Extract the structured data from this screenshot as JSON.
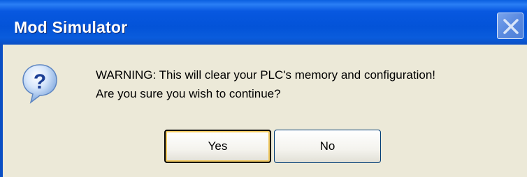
{
  "window": {
    "title": "Mod Simulator"
  },
  "icons": {
    "dialog_icon": "question-icon",
    "close_icon": "close-icon"
  },
  "message": {
    "line1": "WARNING: This will clear your PLC's memory and configuration!",
    "line2": "Are you sure you wish to continue?"
  },
  "buttons": {
    "yes_label": "Yes",
    "no_label": "No"
  },
  "colors": {
    "titlebar": "#0353d8",
    "dialog_background": "#ece9d8",
    "default_button_highlight": "#f0c860"
  }
}
